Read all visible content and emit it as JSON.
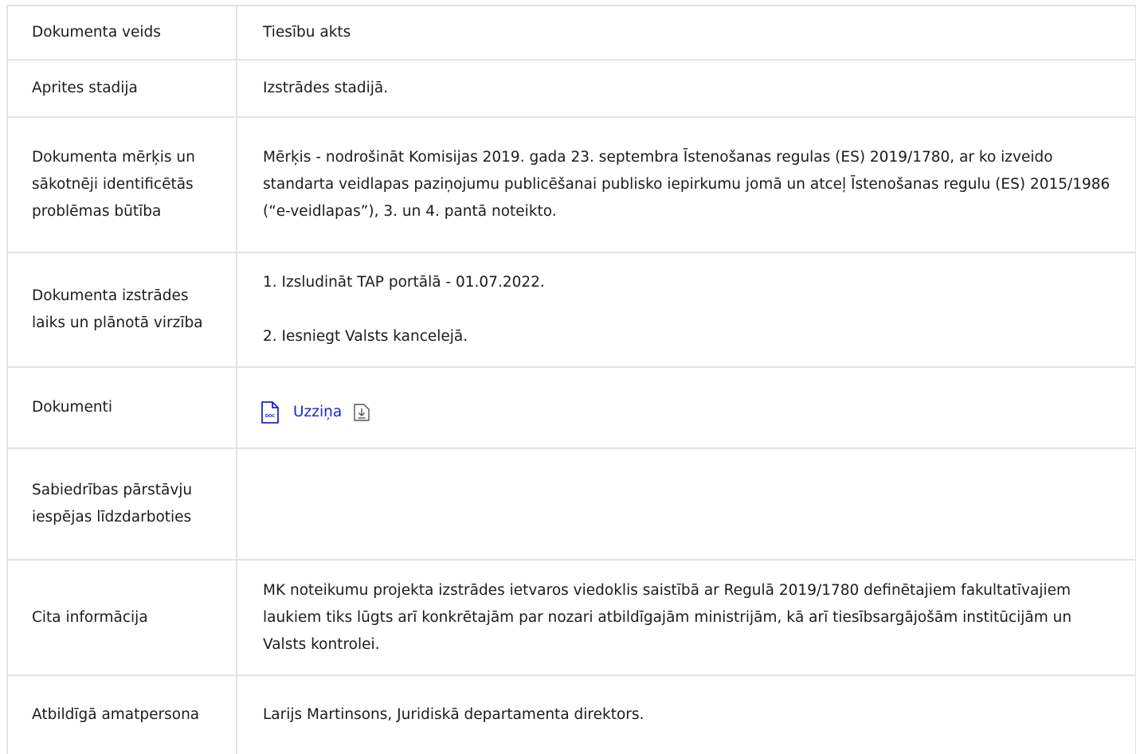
{
  "rows": [
    {
      "label": "Dokumenta veids",
      "value": "Tiesību akts"
    },
    {
      "label": "Aprites stadija",
      "value": "Izstrādes stadijā."
    },
    {
      "label": "Dokumenta mērķis un sākotnēji identificētās problēmas būtība",
      "value": "Mērķis - nodrošināt Komisijas 2019. gada 23. septembra Īstenošanas regulas (ES) 2019/1780, ar ko izveido standarta veidlapas paziņojumu publicēšanai publisko iepirkumu jomā un atceļ Īstenošanas regulu (ES) 2015/1986 (“e-veidlapas”), 3. un 4. pantā noteikto."
    },
    {
      "label": "Dokumenta izstrādes laiks un plānotā virzība",
      "value_lines": [
        "1. Izsludināt TAP portālā - 01.07.2022.",
        "2. Iesniegt Valsts kancelejā."
      ]
    },
    {
      "label": "Dokumenti",
      "document": {
        "name": "Uzziņa",
        "type_badge": "DOC",
        "icon": "doc-file-icon",
        "download_icon": "download-icon"
      }
    },
    {
      "label": "Sabiedrības pārstāvju iespējas līdzdarboties",
      "value": ""
    },
    {
      "label": "Cita informācija",
      "value": "MK noteikumu projekta izstrādes ietvaros viedoklis saistībā ar Regulā 2019/1780 definētajiem fakultatīvajiem laukiem tiks lūgts arī konkrētajām par nozari atbildīgajām ministrijām, kā arī tiesībsargājošām institūcijām un Valsts kontrolei."
    },
    {
      "label": "Atbildīgā amatpersona",
      "value": "Larijs Martinsons, Juridiskā departamenta direktors."
    }
  ],
  "colors": {
    "border": "#e3e3e3",
    "text": "#1c1c1c",
    "link": "#1a25d6"
  }
}
